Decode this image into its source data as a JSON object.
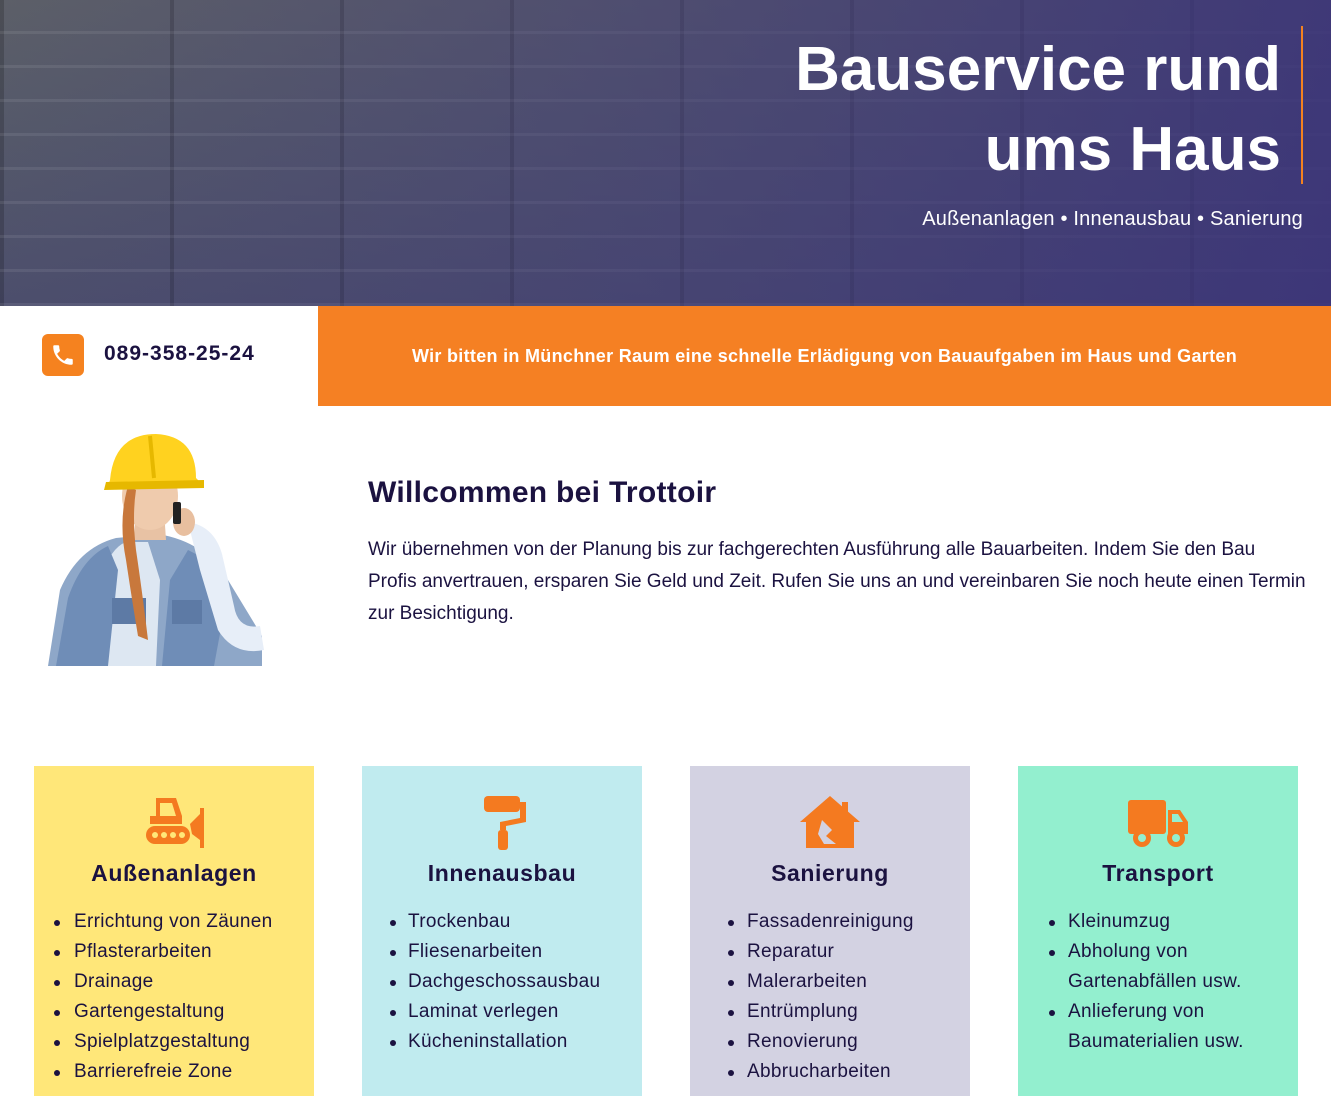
{
  "hero": {
    "title_line1": "Bauservice rund",
    "title_line2": "ums Haus",
    "subtitle": "Außenanlagen • Innenausbau • Sanierung"
  },
  "contact": {
    "phone": "089-358-25-24",
    "icon": "phone-icon"
  },
  "banner": {
    "text": "Wir bitten in Münchner Raum eine schnelle Erlädigung von Bauaufgaben im Haus und Garten"
  },
  "welcome": {
    "title": "Willcommen bei Trottoir",
    "text": "Wir übernehmen von der Planung bis zur fachgerechten Ausführung alle Bauarbeiten. Indem Sie den Bau Profis anvertrauen, ersparen Sie Geld und Zeit. Rufen Sie uns an und vereinbaren Sie noch heute einen Termin zur Besichtigung."
  },
  "colors": {
    "accent": "#f58023",
    "text": "#1b1240",
    "card1": "#ffe779",
    "card2": "#c0ebef",
    "card3": "#d3d2e2",
    "card4": "#93efcf"
  },
  "services": [
    {
      "title": "Außenanlagen",
      "icon": "bulldozer-icon",
      "items": [
        "Errichtung von Zäunen",
        "Pflasterarbeiten",
        "Drainage",
        "Gartengestaltung",
        "Spielplatzgestaltung",
        "Barrierefreie Zone"
      ]
    },
    {
      "title": "Innenausbau",
      "icon": "paint-roller-icon",
      "items": [
        "Trockenbau",
        "Fliesenarbeiten",
        "Dachgeschossausbau",
        "Laminat verlegen",
        "Kücheninstallation"
      ]
    },
    {
      "title": "Sanierung",
      "icon": "house-damage-icon",
      "items": [
        "Fassadenreinigung",
        "Reparatur",
        "Malerarbeiten",
        "Entrümplung",
        "Renovierung",
        "Abbrucharbeiten"
      ]
    },
    {
      "title": "Transport",
      "icon": "truck-icon",
      "items": [
        "Kleinumzug",
        "Abholung von Gartenabfällen usw.",
        "Anlieferung von Baumaterialien usw."
      ]
    }
  ]
}
